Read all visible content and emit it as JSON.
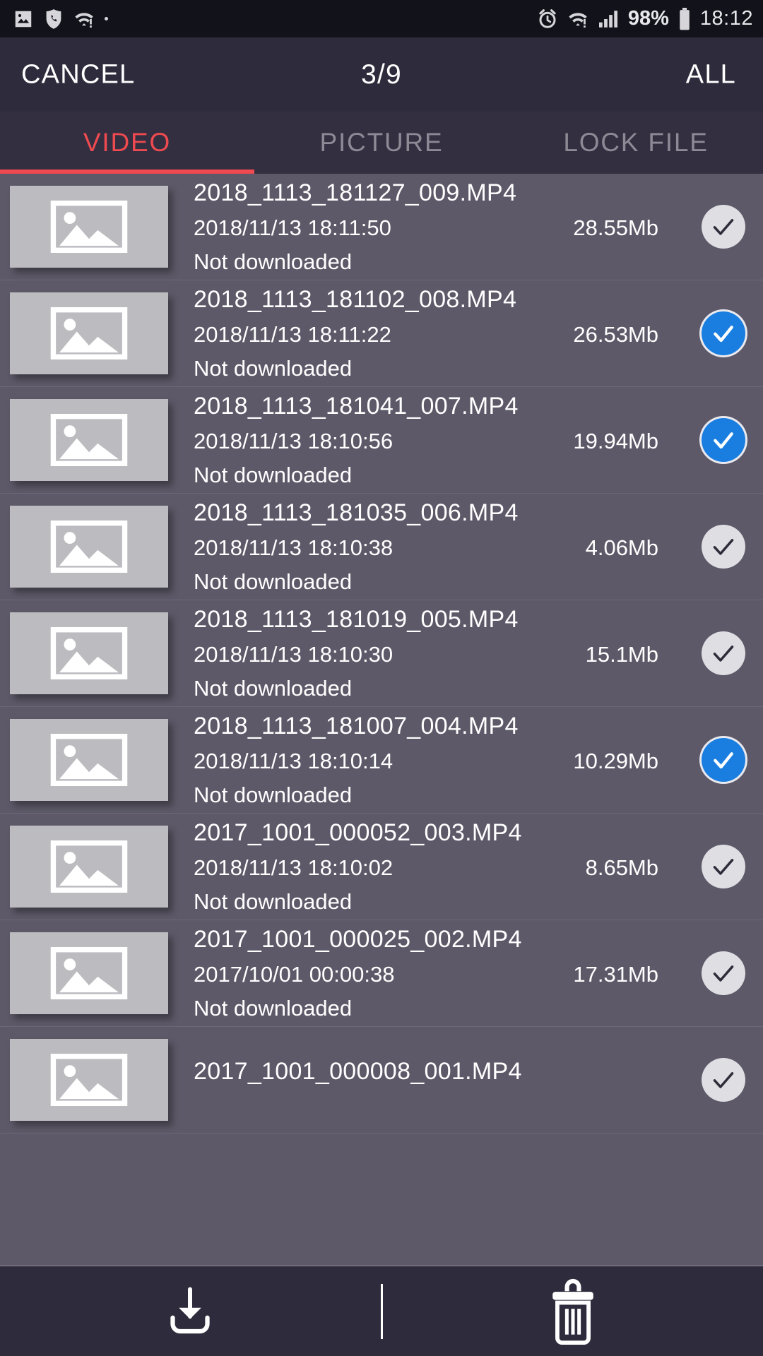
{
  "statusbar": {
    "left_icons": [
      "image-icon",
      "phone-shield-icon",
      "wifi-alert-icon",
      "dot-icon"
    ],
    "right_icons": [
      "alarm-icon",
      "wifi-alert-icon",
      "signal-icon",
      "battery-icon"
    ],
    "battery_percent": "98%",
    "time": "18:12"
  },
  "actionbar": {
    "cancel_label": "CANCEL",
    "selection_count": "3/9",
    "all_label": "ALL"
  },
  "tabs": [
    {
      "label": "VIDEO",
      "active": true
    },
    {
      "label": "PICTURE",
      "active": false
    },
    {
      "label": "LOCK FILE",
      "active": false
    }
  ],
  "colors": {
    "accent": "#ef4a50",
    "checked": "#1a7ee0",
    "unchecked": "#dedee3",
    "list_bg": "#5d5968",
    "bar_bg": "#2e2b3c",
    "tab_bg": "#332f41",
    "statusbar_bg": "#12121a"
  },
  "files": [
    {
      "name": "2018_1113_181127_009.MP4",
      "date": "2018/11/13 18:11:50",
      "size": "28.55Mb",
      "status": "Not downloaded",
      "selected": false
    },
    {
      "name": "2018_1113_181102_008.MP4",
      "date": "2018/11/13 18:11:22",
      "size": "26.53Mb",
      "status": "Not downloaded",
      "selected": true
    },
    {
      "name": "2018_1113_181041_007.MP4",
      "date": "2018/11/13 18:10:56",
      "size": "19.94Mb",
      "status": "Not downloaded",
      "selected": true
    },
    {
      "name": "2018_1113_181035_006.MP4",
      "date": "2018/11/13 18:10:38",
      "size": "4.06Mb",
      "status": "Not downloaded",
      "selected": false
    },
    {
      "name": "2018_1113_181019_005.MP4",
      "date": "2018/11/13 18:10:30",
      "size": "15.1Mb",
      "status": "Not downloaded",
      "selected": false
    },
    {
      "name": "2018_1113_181007_004.MP4",
      "date": "2018/11/13 18:10:14",
      "size": "10.29Mb",
      "status": "Not downloaded",
      "selected": true
    },
    {
      "name": "2017_1001_000052_003.MP4",
      "date": "2018/11/13 18:10:02",
      "size": "8.65Mb",
      "status": "Not downloaded",
      "selected": false
    },
    {
      "name": "2017_1001_000025_002.MP4",
      "date": "2017/10/01 00:00:38",
      "size": "17.31Mb",
      "status": "Not downloaded",
      "selected": false
    },
    {
      "name": "2017_1001_000008_001.MP4",
      "date": "",
      "size": "",
      "status": "",
      "selected": false
    }
  ],
  "bottombar": {
    "download_label": "download-icon",
    "delete_label": "trash-icon"
  }
}
